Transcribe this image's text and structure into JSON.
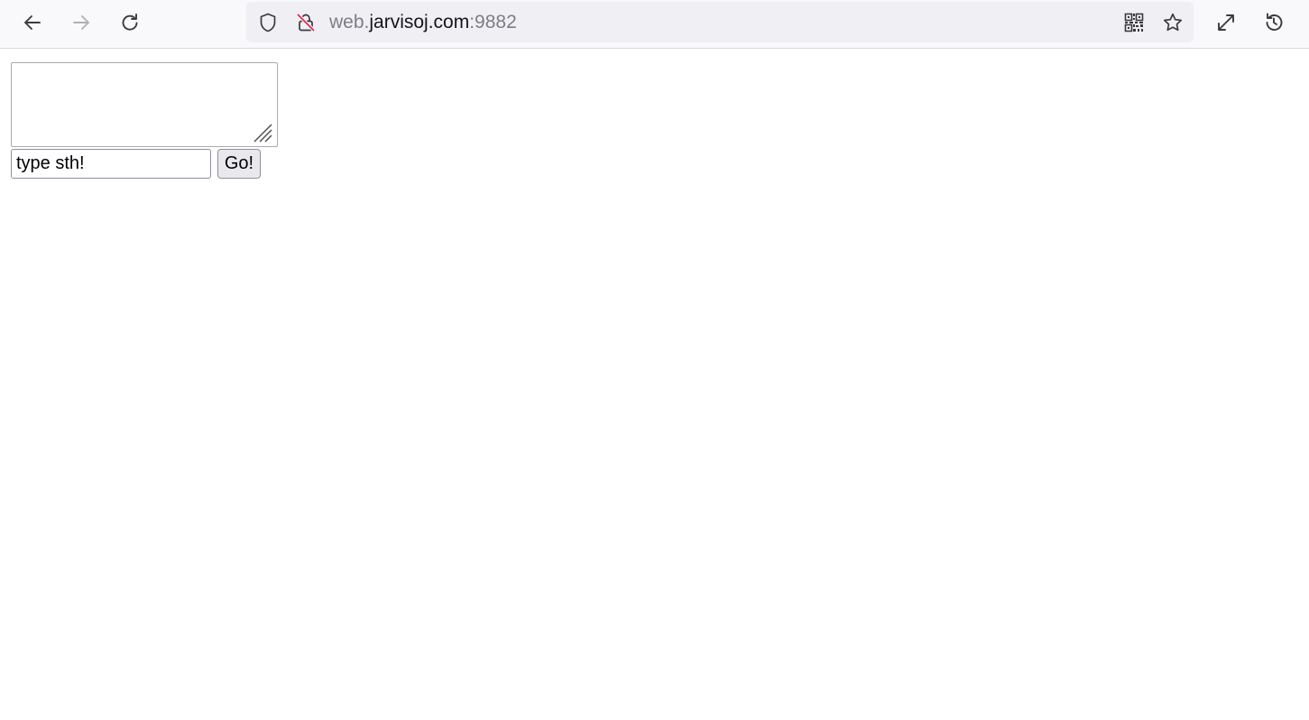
{
  "browser": {
    "url": {
      "prefix": "web.",
      "domain": "jarvisoj.com",
      "port": ":9882"
    },
    "icons": {
      "back": "arrow-left-icon",
      "forward": "arrow-right-icon",
      "reload": "reload-icon",
      "tracking_protection": "shield-icon",
      "insecure": "lock-slash-icon",
      "qr": "qr-code-icon",
      "bookmark": "star-icon",
      "fullscreen": "expand-icon",
      "history": "history-icon"
    },
    "colors": {
      "toolbar_bg": "#f9f9fb",
      "urlbar_bg": "#f0f0f4",
      "insecure_slash": "#e22850"
    }
  },
  "page": {
    "textarea_value": "",
    "input_value": "type sth!",
    "submit_label": "Go!"
  }
}
